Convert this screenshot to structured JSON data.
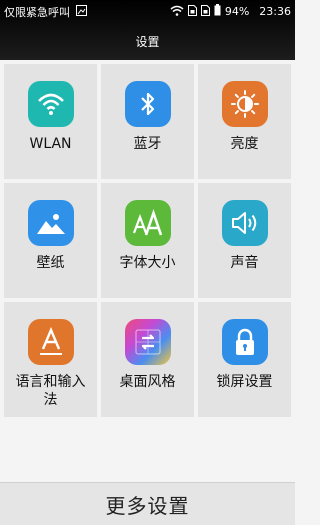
{
  "status_bar": {
    "carrier": "仅限紧急呼叫",
    "battery": "94%",
    "time": "23:36"
  },
  "title": "设置",
  "tiles": [
    {
      "label": "WLAN",
      "icon": "wifi-icon",
      "color": "#1fb8b0"
    },
    {
      "label": "蓝牙",
      "icon": "bluetooth-icon",
      "color": "#2f8fe6"
    },
    {
      "label": "亮度",
      "icon": "brightness-icon",
      "color": "#e2762f"
    },
    {
      "label": "壁纸",
      "icon": "wallpaper-icon",
      "color": "#2f91e8"
    },
    {
      "label": "字体大小",
      "icon": "font-size-icon",
      "color": "#5cb93a"
    },
    {
      "label": "声音",
      "icon": "sound-icon",
      "color": "#2aa8c9"
    },
    {
      "label": "语言和输入法",
      "icon": "language-icon",
      "color": "#e0752c"
    },
    {
      "label": "桌面风格",
      "icon": "desktop-style-icon",
      "color": "#b34ad8"
    },
    {
      "label": "锁屏设置",
      "icon": "lock-icon",
      "color": "#2f8fe6"
    }
  ],
  "more_button": "更多设置"
}
